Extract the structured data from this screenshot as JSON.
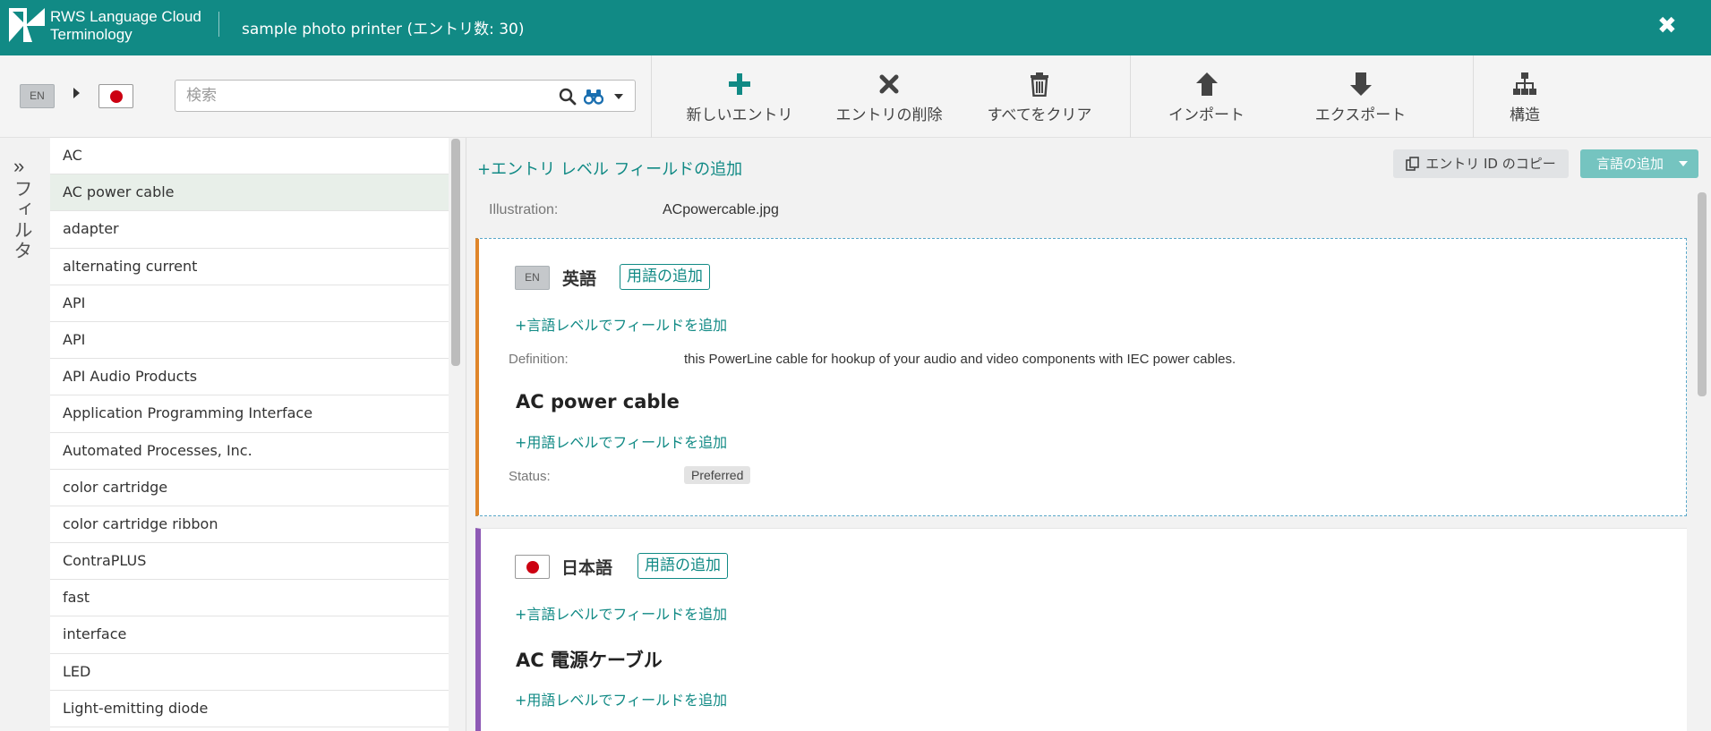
{
  "header": {
    "brand_line1": "RWS Language Cloud",
    "brand_line2": "Terminology",
    "title": "sample photo printer (エントリ数: 30)",
    "close": "✖"
  },
  "toolbar": {
    "source_lang": "EN",
    "search_placeholder": "検索",
    "new_entry": "新しいエントリ",
    "delete_entry": "エントリの削除",
    "clear_all": "すべてをクリア",
    "import": "インポート",
    "export": "エクスポート",
    "structure": "構造"
  },
  "filter": {
    "label": "フィルタ",
    "toggle": "»"
  },
  "entries": [
    "AC",
    "AC power cable",
    "adapter",
    "alternating current",
    "API",
    "API",
    "API Audio Products",
    "Application Programming Interface",
    "Automated Processes, Inc.",
    "color cartridge",
    "color cartridge ribbon",
    "ContraPLUS",
    "fast",
    "interface",
    "LED",
    "Light-emitting diode"
  ],
  "selected_entry_index": 1,
  "entry": {
    "add_entry_field": "エントリ レベル フィールドの追加",
    "copy_id": "エントリ ID のコピー",
    "add_language": "言語の追加",
    "illustration_label": "Illustration:",
    "illustration_value": "ACpowercable.jpg"
  },
  "en_section": {
    "lang_code": "EN",
    "lang_name": "英語",
    "add_term": "用語の追加",
    "add_lang_field": "言語レベルでフィールドを追加",
    "definition_label": "Definition:",
    "definition_value": "this PowerLine cable for hookup of your audio and video components with IEC power cables.",
    "term": "AC power cable",
    "add_term_field": "用語レベルでフィールドを追加",
    "status_label": "Status:",
    "status_value": "Preferred"
  },
  "ja_section": {
    "lang_name": "日本語",
    "add_term": "用語の追加",
    "add_lang_field": "言語レベルでフィールドを追加",
    "term": "AC 電源ケーブル",
    "add_term_field": "用語レベルでフィールドを追加"
  },
  "colors": {
    "brand": "#118a85",
    "en_accent": "#e0862b",
    "ja_accent": "#8e5ab5",
    "flag_red": "#cc0011"
  }
}
